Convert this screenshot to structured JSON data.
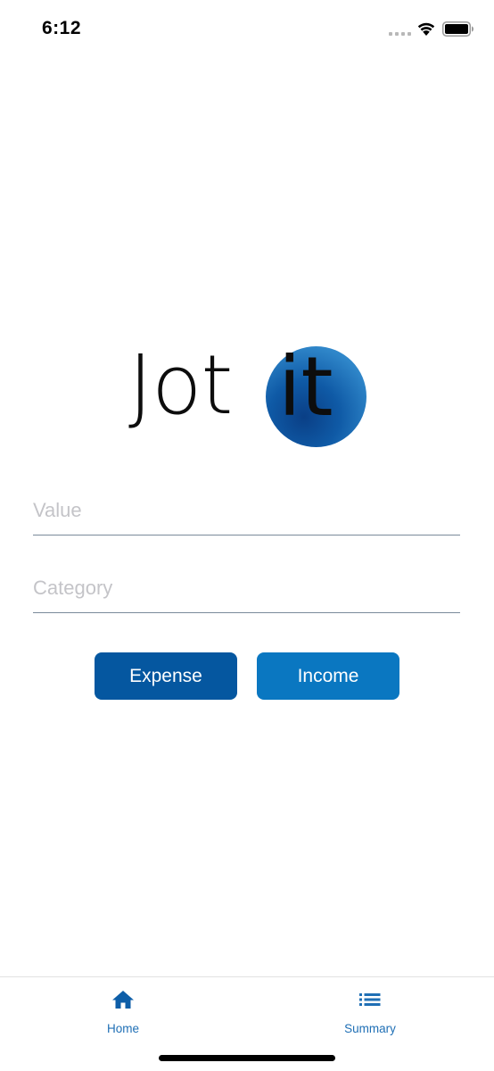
{
  "status_bar": {
    "time": "6:12",
    "icons": [
      "signal-dots-icon",
      "wifi-icon",
      "battery-icon"
    ]
  },
  "logo": {
    "text_left": "Jot",
    "text_right": "it",
    "circle_color": "#1565b0"
  },
  "form": {
    "value_placeholder": "Value",
    "value_text": "",
    "category_placeholder": "Category",
    "category_text": ""
  },
  "buttons": {
    "expense_label": "Expense",
    "income_label": "Income",
    "expense_color": "#0557a0",
    "income_color": "#0a77c1"
  },
  "tab_bar": {
    "tabs": [
      {
        "label": "Home",
        "icon": "home-icon"
      },
      {
        "label": "Summary",
        "icon": "list-icon"
      }
    ],
    "accent_color": "#1f6fb5"
  }
}
